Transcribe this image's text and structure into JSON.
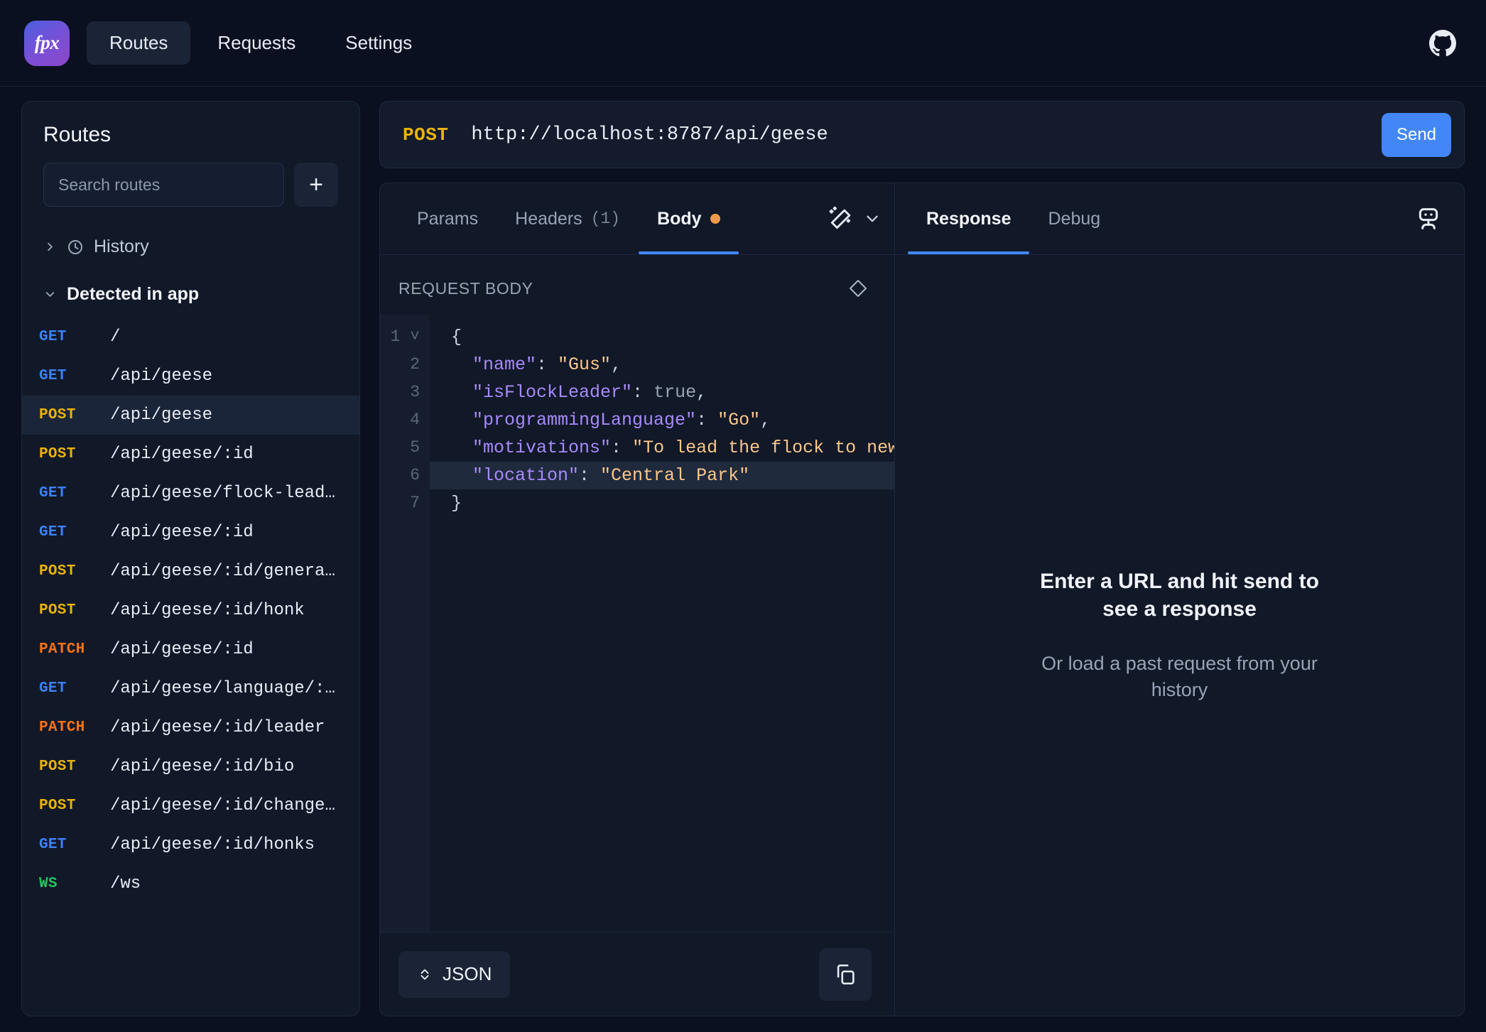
{
  "app": {
    "logo_text": "fpx",
    "nav": [
      {
        "label": "Routes",
        "active": true
      },
      {
        "label": "Requests",
        "active": false
      },
      {
        "label": "Settings",
        "active": false
      }
    ],
    "github_icon": "github-icon"
  },
  "sidebar": {
    "title": "Routes",
    "search_placeholder": "Search routes",
    "search_value": "",
    "add_label": "+",
    "groups": [
      {
        "label": "History",
        "expanded": false,
        "icon": "clock-icon"
      },
      {
        "label": "Detected in app",
        "expanded": true
      }
    ],
    "routes": [
      {
        "method": "GET",
        "path": "/"
      },
      {
        "method": "GET",
        "path": "/api/geese"
      },
      {
        "method": "POST",
        "path": "/api/geese",
        "selected": true
      },
      {
        "method": "POST",
        "path": "/api/geese/:id"
      },
      {
        "method": "GET",
        "path": "/api/geese/flock-leaders"
      },
      {
        "method": "GET",
        "path": "/api/geese/:id"
      },
      {
        "method": "POST",
        "path": "/api/geese/:id/generate"
      },
      {
        "method": "POST",
        "path": "/api/geese/:id/honk"
      },
      {
        "method": "PATCH",
        "path": "/api/geese/:id"
      },
      {
        "method": "GET",
        "path": "/api/geese/language/:language"
      },
      {
        "method": "PATCH",
        "path": "/api/geese/:id/leader"
      },
      {
        "method": "POST",
        "path": "/api/geese/:id/bio"
      },
      {
        "method": "POST",
        "path": "/api/geese/:id/change-name-url-form"
      },
      {
        "method": "GET",
        "path": "/api/geese/:id/honks"
      },
      {
        "method": "WS",
        "path": "/ws"
      }
    ]
  },
  "request": {
    "method": "POST",
    "url": "http://localhost:8787/api/geese",
    "send_label": "Send",
    "tabs": [
      {
        "label": "Params",
        "active": false
      },
      {
        "label": "Headers",
        "count": "(1)",
        "active": false
      },
      {
        "label": "Body",
        "active": true,
        "dot": true
      }
    ],
    "wand_icon": "magic-wand-icon",
    "chevron_icon": "chevron-down-icon",
    "body_label": "REQUEST BODY",
    "diamond_icon": "diamond-icon",
    "content_type": "JSON",
    "copy_icon": "copy-icon",
    "code_lines": [
      {
        "n": "1",
        "fold": true,
        "tokens": [
          {
            "t": "{",
            "c": "p"
          }
        ]
      },
      {
        "n": "2",
        "tokens": [
          {
            "t": "  \"name\"",
            "c": "k"
          },
          {
            "t": ": ",
            "c": "p"
          },
          {
            "t": "\"Gus\"",
            "c": "s"
          },
          {
            "t": ",",
            "c": "p"
          }
        ]
      },
      {
        "n": "3",
        "tokens": [
          {
            "t": "  \"isFlockLeader\"",
            "c": "k"
          },
          {
            "t": ": ",
            "c": "p"
          },
          {
            "t": "true",
            "c": "b"
          },
          {
            "t": ",",
            "c": "p"
          }
        ]
      },
      {
        "n": "4",
        "tokens": [
          {
            "t": "  \"programmingLanguage\"",
            "c": "k"
          },
          {
            "t": ": ",
            "c": "p"
          },
          {
            "t": "\"Go\"",
            "c": "s"
          },
          {
            "t": ",",
            "c": "p"
          }
        ]
      },
      {
        "n": "5",
        "tokens": [
          {
            "t": "  \"motivations\"",
            "c": "k"
          },
          {
            "t": ": ",
            "c": "p"
          },
          {
            "t": "\"To lead the flock to new heights\"",
            "c": "s"
          }
        ]
      },
      {
        "n": "6",
        "highlight": true,
        "tokens": [
          {
            "t": "  \"location\"",
            "c": "k"
          },
          {
            "t": ": ",
            "c": "p"
          },
          {
            "t": "\"Central Park\"",
            "c": "s"
          }
        ]
      },
      {
        "n": "7",
        "tokens": [
          {
            "t": "}",
            "c": "p"
          }
        ]
      }
    ]
  },
  "response": {
    "tabs": [
      {
        "label": "Response",
        "active": true
      },
      {
        "label": "Debug",
        "active": false
      }
    ],
    "robot_icon": "robot-icon",
    "empty_title": "Enter a URL and hit send to see a response",
    "empty_subtitle": "Or load a past request from your history"
  },
  "colors": {
    "accent": "#4287f5",
    "get": "#3b82f6",
    "post": "#eab308",
    "patch": "#f97316",
    "ws": "#22c55e",
    "body_dot": "#f0994a"
  }
}
